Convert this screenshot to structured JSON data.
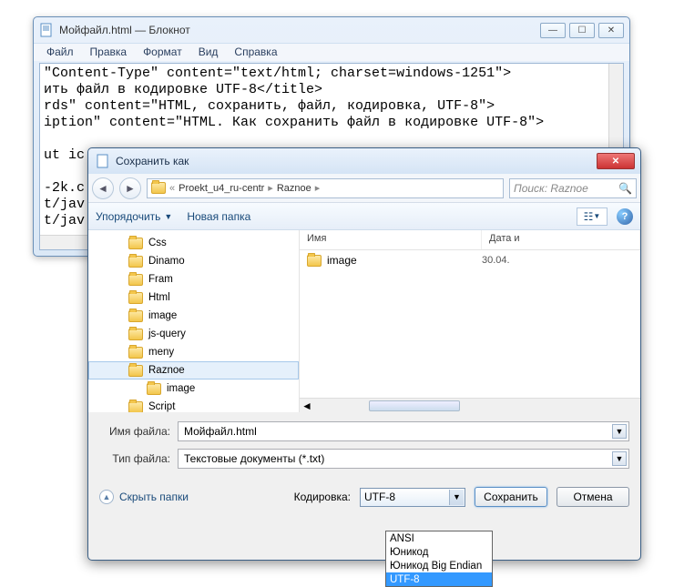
{
  "notepad": {
    "title": "Мойфайл.html — Блокнот",
    "menu": [
      "Файл",
      "Правка",
      "Формат",
      "Вид",
      "Справка"
    ],
    "content": "\"Content-Type\" content=\"text/html; charset=windows-1251\">\nить файл в кодировке UTF-8</title>\nrds\" content=\"HTML, сохранить, файл, кодировка, UTF-8\">\niption\" content=\"HTML. Как сохранить файл в кодировке UTF-8\">\n\nut ic\n\n-2k.c\nt/jav\nt/jav"
  },
  "save": {
    "title": "Сохранить как",
    "breadcrumb": [
      "Proekt_u4_ru-centr",
      "Raznoe"
    ],
    "search_placeholder": "Поиск: Raznoe",
    "toolbar": {
      "organize": "Упорядочить",
      "newfolder": "Новая папка"
    },
    "tree": [
      {
        "name": "Css",
        "sub": false
      },
      {
        "name": "Dinamo",
        "sub": false
      },
      {
        "name": "Fram",
        "sub": false
      },
      {
        "name": "Html",
        "sub": false
      },
      {
        "name": "image",
        "sub": false
      },
      {
        "name": "js-query",
        "sub": false
      },
      {
        "name": "meny",
        "sub": false
      },
      {
        "name": "Raznoe",
        "sub": false,
        "selected": true
      },
      {
        "name": "image",
        "sub": true
      },
      {
        "name": "Script",
        "sub": false
      }
    ],
    "list": {
      "headers": {
        "name": "Имя",
        "date": "Дата и"
      },
      "rows": [
        {
          "name": "image",
          "date": "30.04."
        }
      ]
    },
    "fields": {
      "filename_label": "Имя файла:",
      "filename_value": "Мойфайл.html",
      "type_label": "Тип файла:",
      "type_value": "Текстовые документы (*.txt)"
    },
    "hide_folders": "Скрыть папки",
    "encoding_label": "Кодировка:",
    "encoding_value": "UTF-8",
    "encoding_options": [
      "ANSI",
      "Юникод",
      "Юникод Big Endian",
      "UTF-8"
    ],
    "buttons": {
      "save": "Сохранить",
      "cancel": "Отмена"
    }
  }
}
